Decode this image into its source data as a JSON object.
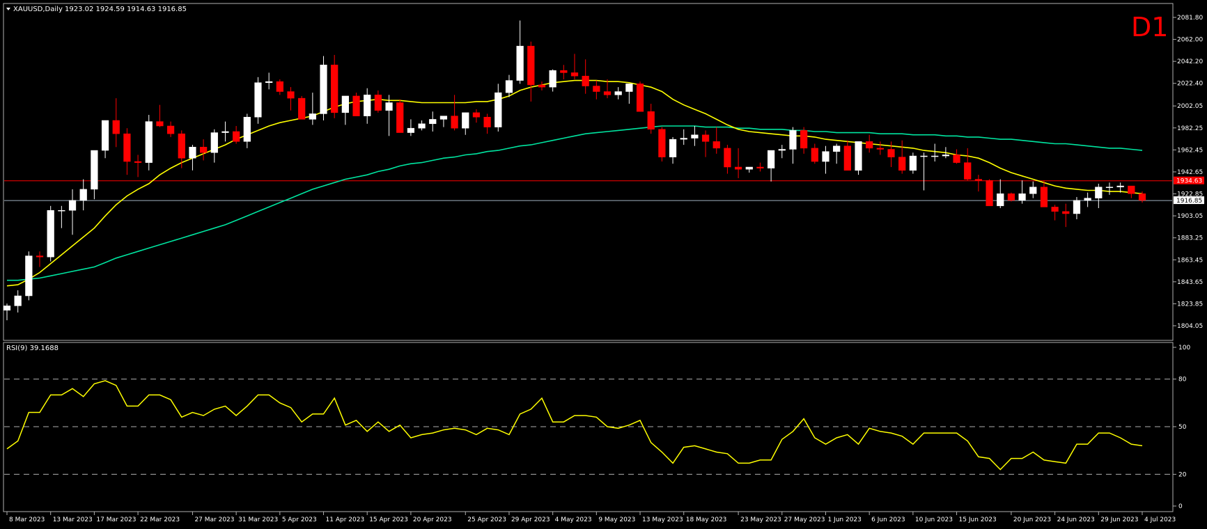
{
  "header": {
    "symbol": "XAUUSD,Daily",
    "ohlc": "1923.02 1924.59 1914.63 1916.85",
    "timeframe": "D1"
  },
  "rsi_label": "RSI(9) 39.1688",
  "price_axis": [
    "2081.80",
    "2062.00",
    "2042.20",
    "2022.40",
    "2002.05",
    "1982.25",
    "1962.45",
    "1942.65",
    "1922.85",
    "1903.05",
    "1883.25",
    "1863.45",
    "1843.65",
    "1823.85",
    "1804.05"
  ],
  "rsi_axis": [
    "100",
    "80",
    "50",
    "20",
    "0"
  ],
  "price_tags": {
    "red_line": "1934.63",
    "current": "1916.85"
  },
  "date_labels": [
    "8 Mar 2023",
    "13 Mar 2023",
    "17 Mar 2023",
    "22 Mar 2023",
    "27 Mar 2023",
    "31 Mar 2023",
    "5 Apr 2023",
    "11 Apr 2023",
    "15 Apr 2023",
    "20 Apr 2023",
    "25 Apr 2023",
    "29 Apr 2023",
    "4 May 2023",
    "9 May 2023",
    "13 May 2023",
    "18 May 2023",
    "23 May 2023",
    "27 May 2023",
    "1 Jun 2023",
    "6 Jun 2023",
    "10 Jun 2023",
    "15 Jun 2023",
    "20 Jun 2023",
    "24 Jun 2023",
    "29 Jun 2023",
    "4 Jul 2023"
  ],
  "colors": {
    "bull": "#ffffff",
    "bear": "#ff0000",
    "ma_fast": "#ffff00",
    "ma_slow": "#00e5a0",
    "rsi": "#ffff00",
    "h_red": "#ff0000",
    "h_current": "#a0b0c0"
  },
  "chart_data": {
    "type": "candlestick",
    "timeframe": "Daily",
    "ylim": [
      1804.05,
      2081.8
    ],
    "candles": [
      {
        "o": 1818,
        "h": 1824,
        "l": 1809,
        "c": 1822
      },
      {
        "o": 1822,
        "h": 1836,
        "l": 1816,
        "c": 1831
      },
      {
        "o": 1831,
        "h": 1871,
        "l": 1827,
        "c": 1867
      },
      {
        "o": 1867,
        "h": 1871,
        "l": 1857,
        "c": 1866
      },
      {
        "o": 1866,
        "h": 1912,
        "l": 1862,
        "c": 1908
      },
      {
        "o": 1908,
        "h": 1912,
        "l": 1892,
        "c": 1908
      },
      {
        "o": 1908,
        "h": 1927,
        "l": 1886,
        "c": 1917
      },
      {
        "o": 1917,
        "h": 1936,
        "l": 1908,
        "c": 1927
      },
      {
        "o": 1927,
        "h": 1939,
        "l": 1918,
        "c": 1962
      },
      {
        "o": 1962,
        "h": 1986,
        "l": 1955,
        "c": 1989
      },
      {
        "o": 1989,
        "h": 2009,
        "l": 1965,
        "c": 1977
      },
      {
        "o": 1977,
        "h": 1982,
        "l": 1940,
        "c": 1952
      },
      {
        "o": 1952,
        "h": 1958,
        "l": 1938,
        "c": 1951
      },
      {
        "o": 1951,
        "h": 1994,
        "l": 1944,
        "c": 1988
      },
      {
        "o": 1988,
        "h": 2003,
        "l": 1983,
        "c": 1984
      },
      {
        "o": 1984,
        "h": 1988,
        "l": 1974,
        "c": 1977
      },
      {
        "o": 1977,
        "h": 1980,
        "l": 1946,
        "c": 1955
      },
      {
        "o": 1955,
        "h": 1967,
        "l": 1944,
        "c": 1965
      },
      {
        "o": 1965,
        "h": 1972,
        "l": 1953,
        "c": 1960
      },
      {
        "o": 1960,
        "h": 1981,
        "l": 1951,
        "c": 1978
      },
      {
        "o": 1978,
        "h": 1988,
        "l": 1970,
        "c": 1979
      },
      {
        "o": 1979,
        "h": 1984,
        "l": 1968,
        "c": 1970
      },
      {
        "o": 1970,
        "h": 1995,
        "l": 1964,
        "c": 1992
      },
      {
        "o": 1992,
        "h": 2028,
        "l": 1986,
        "c": 2023
      },
      {
        "o": 2023,
        "h": 2032,
        "l": 2017,
        "c": 2024
      },
      {
        "o": 2024,
        "h": 2026,
        "l": 2012,
        "c": 2015
      },
      {
        "o": 2015,
        "h": 2019,
        "l": 1998,
        "c": 2009
      },
      {
        "o": 2009,
        "h": 2011,
        "l": 1992,
        "c": 1990
      },
      {
        "o": 1990,
        "h": 2014,
        "l": 1985,
        "c": 1995
      },
      {
        "o": 1995,
        "h": 2047,
        "l": 1989,
        "c": 2039
      },
      {
        "o": 2039,
        "h": 2048,
        "l": 1991,
        "c": 1996
      },
      {
        "o": 1996,
        "h": 2008,
        "l": 1985,
        "c": 2011
      },
      {
        "o": 2011,
        "h": 2014,
        "l": 1998,
        "c": 1993
      },
      {
        "o": 1993,
        "h": 2018,
        "l": 1986,
        "c": 2012
      },
      {
        "o": 2012,
        "h": 2016,
        "l": 1996,
        "c": 1998
      },
      {
        "o": 1998,
        "h": 2012,
        "l": 1975,
        "c": 2005
      },
      {
        "o": 2005,
        "h": 2008,
        "l": 1978,
        "c": 1978
      },
      {
        "o": 1978,
        "h": 1990,
        "l": 1975,
        "c": 1982
      },
      {
        "o": 1982,
        "h": 1989,
        "l": 1980,
        "c": 1986
      },
      {
        "o": 1986,
        "h": 1997,
        "l": 1979,
        "c": 1990
      },
      {
        "o": 1990,
        "h": 1992,
        "l": 1983,
        "c": 1993
      },
      {
        "o": 1993,
        "h": 2012,
        "l": 1980,
        "c": 1982
      },
      {
        "o": 1982,
        "h": 1996,
        "l": 1976,
        "c": 1996
      },
      {
        "o": 1996,
        "h": 1999,
        "l": 1987,
        "c": 1992
      },
      {
        "o": 1992,
        "h": 1995,
        "l": 1977,
        "c": 1983
      },
      {
        "o": 1983,
        "h": 2022,
        "l": 1979,
        "c": 2014
      },
      {
        "o": 2014,
        "h": 2030,
        "l": 2010,
        "c": 2025
      },
      {
        "o": 2025,
        "h": 2079,
        "l": 2022,
        "c": 2056
      },
      {
        "o": 2056,
        "h": 2060,
        "l": 2006,
        "c": 2021
      },
      {
        "o": 2021,
        "h": 2024,
        "l": 2016,
        "c": 2019
      },
      {
        "o": 2019,
        "h": 2035,
        "l": 2015,
        "c": 2034
      },
      {
        "o": 2034,
        "h": 2039,
        "l": 2026,
        "c": 2032
      },
      {
        "o": 2032,
        "h": 2049,
        "l": 2026,
        "c": 2029
      },
      {
        "o": 2029,
        "h": 2044,
        "l": 2013,
        "c": 2020
      },
      {
        "o": 2020,
        "h": 2025,
        "l": 2008,
        "c": 2015
      },
      {
        "o": 2015,
        "h": 2026,
        "l": 2009,
        "c": 2012
      },
      {
        "o": 2012,
        "h": 2019,
        "l": 2008,
        "c": 2015
      },
      {
        "o": 2015,
        "h": 2022,
        "l": 2004,
        "c": 2022
      },
      {
        "o": 2022,
        "h": 2024,
        "l": 1997,
        "c": 1997
      },
      {
        "o": 1997,
        "h": 2004,
        "l": 1977,
        "c": 1981
      },
      {
        "o": 1981,
        "h": 1983,
        "l": 1952,
        "c": 1956
      },
      {
        "o": 1956,
        "h": 1974,
        "l": 1950,
        "c": 1972
      },
      {
        "o": 1972,
        "h": 1981,
        "l": 1967,
        "c": 1973
      },
      {
        "o": 1973,
        "h": 1984,
        "l": 1966,
        "c": 1976
      },
      {
        "o": 1976,
        "h": 1980,
        "l": 1956,
        "c": 1970
      },
      {
        "o": 1970,
        "h": 1983,
        "l": 1959,
        "c": 1964
      },
      {
        "o": 1964,
        "h": 1967,
        "l": 1941,
        "c": 1947
      },
      {
        "o": 1947,
        "h": 1964,
        "l": 1937,
        "c": 1945
      },
      {
        "o": 1945,
        "h": 1947,
        "l": 1942,
        "c": 1947
      },
      {
        "o": 1947,
        "h": 1951,
        "l": 1943,
        "c": 1946
      },
      {
        "o": 1946,
        "h": 1951,
        "l": 1934,
        "c": 1962
      },
      {
        "o": 1962,
        "h": 1967,
        "l": 1955,
        "c": 1963
      },
      {
        "o": 1963,
        "h": 1983,
        "l": 1950,
        "c": 1980
      },
      {
        "o": 1980,
        "h": 1983,
        "l": 1959,
        "c": 1964
      },
      {
        "o": 1964,
        "h": 1968,
        "l": 1950,
        "c": 1952
      },
      {
        "o": 1952,
        "h": 1966,
        "l": 1941,
        "c": 1961
      },
      {
        "o": 1961,
        "h": 1968,
        "l": 1950,
        "c": 1966
      },
      {
        "o": 1966,
        "h": 1971,
        "l": 1945,
        "c": 1944
      },
      {
        "o": 1944,
        "h": 1970,
        "l": 1940,
        "c": 1970
      },
      {
        "o": 1970,
        "h": 1976,
        "l": 1960,
        "c": 1964
      },
      {
        "o": 1964,
        "h": 1970,
        "l": 1958,
        "c": 1963
      },
      {
        "o": 1963,
        "h": 1970,
        "l": 1947,
        "c": 1956
      },
      {
        "o": 1956,
        "h": 1971,
        "l": 1941,
        "c": 1944
      },
      {
        "o": 1944,
        "h": 1960,
        "l": 1941,
        "c": 1957
      },
      {
        "o": 1957,
        "h": 1960,
        "l": 1926,
        "c": 1957
      },
      {
        "o": 1957,
        "h": 1968,
        "l": 1952,
        "c": 1957
      },
      {
        "o": 1957,
        "h": 1965,
        "l": 1955,
        "c": 1958
      },
      {
        "o": 1958,
        "h": 1963,
        "l": 1950,
        "c": 1951
      },
      {
        "o": 1951,
        "h": 1964,
        "l": 1935,
        "c": 1936
      },
      {
        "o": 1936,
        "h": 1940,
        "l": 1925,
        "c": 1935
      },
      {
        "o": 1935,
        "h": 1936,
        "l": 1912,
        "c": 1912
      },
      {
        "o": 1912,
        "h": 1936,
        "l": 1910,
        "c": 1923
      },
      {
        "o": 1923,
        "h": 1924,
        "l": 1916,
        "c": 1917
      },
      {
        "o": 1917,
        "h": 1935,
        "l": 1914,
        "c": 1923
      },
      {
        "o": 1923,
        "h": 1934,
        "l": 1919,
        "c": 1929
      },
      {
        "o": 1929,
        "h": 1935,
        "l": 1912,
        "c": 1911
      },
      {
        "o": 1911,
        "h": 1913,
        "l": 1899,
        "c": 1907
      },
      {
        "o": 1907,
        "h": 1914,
        "l": 1893,
        "c": 1905
      },
      {
        "o": 1905,
        "h": 1920,
        "l": 1900,
        "c": 1917
      },
      {
        "o": 1917,
        "h": 1924,
        "l": 1911,
        "c": 1919
      },
      {
        "o": 1919,
        "h": 1932,
        "l": 1910,
        "c": 1929
      },
      {
        "o": 1929,
        "h": 1933,
        "l": 1922,
        "c": 1929
      },
      {
        "o": 1929,
        "h": 1933,
        "l": 1924,
        "c": 1930
      },
      {
        "o": 1930,
        "h": 1930,
        "l": 1919,
        "c": 1923
      },
      {
        "o": 1923,
        "h": 1925,
        "l": 1915,
        "c": 1917
      }
    ],
    "ma_fast": [
      1840,
      1841,
      1846,
      1852,
      1860,
      1868,
      1876,
      1884,
      1892,
      1903,
      1913,
      1921,
      1927,
      1932,
      1940,
      1946,
      1951,
      1955,
      1959,
      1963,
      1967,
      1972,
      1976,
      1980,
      1984,
      1987,
      1989,
      1991,
      1993,
      1997,
      2001,
      2004,
      2006,
      2007,
      2008,
      2007,
      2007,
      2006,
      2005,
      2005,
      2005,
      2005,
      2005,
      2006,
      2006,
      2008,
      2011,
      2016,
      2019,
      2021,
      2023,
      2024,
      2025,
      2025,
      2025,
      2024,
      2024,
      2023,
      2021,
      2019,
      2015,
      2008,
      2003,
      1999,
      1995,
      1990,
      1985,
      1981,
      1979,
      1978,
      1977,
      1976,
      1975,
      1975,
      1974,
      1972,
      1971,
      1970,
      1969,
      1968,
      1967,
      1966,
      1965,
      1964,
      1962,
      1961,
      1960,
      1958,
      1957,
      1955,
      1951,
      1946,
      1942,
      1939,
      1936,
      1933,
      1930,
      1928,
      1927,
      1926,
      1926,
      1925,
      1925,
      1924,
      1923
    ],
    "ma_slow": [
      1845,
      1845,
      1846,
      1847,
      1849,
      1851,
      1853,
      1855,
      1857,
      1861,
      1865,
      1868,
      1871,
      1874,
      1877,
      1880,
      1883,
      1886,
      1889,
      1892,
      1895,
      1899,
      1903,
      1907,
      1911,
      1915,
      1919,
      1923,
      1927,
      1930,
      1933,
      1936,
      1938,
      1940,
      1943,
      1945,
      1948,
      1950,
      1951,
      1953,
      1955,
      1956,
      1958,
      1959,
      1961,
      1962,
      1964,
      1966,
      1967,
      1969,
      1971,
      1973,
      1975,
      1977,
      1978,
      1979,
      1980,
      1981,
      1982,
      1983,
      1984,
      1984,
      1984,
      1984,
      1983,
      1983,
      1983,
      1982,
      1982,
      1981,
      1981,
      1981,
      1980,
      1980,
      1979,
      1979,
      1978,
      1978,
      1978,
      1978,
      1977,
      1977,
      1977,
      1976,
      1976,
      1976,
      1975,
      1975,
      1974,
      1974,
      1973,
      1972,
      1972,
      1971,
      1970,
      1969,
      1968,
      1968,
      1967,
      1966,
      1965,
      1964,
      1964,
      1963,
      1962
    ],
    "rsi": [
      36,
      41,
      59,
      59,
      70,
      70,
      74,
      69,
      77,
      79,
      76,
      63,
      63,
      70,
      70,
      67,
      56,
      59,
      57,
      61,
      63,
      57,
      63,
      70,
      70,
      65,
      62,
      53,
      58,
      58,
      68,
      51,
      54,
      47,
      53,
      47,
      51,
      43,
      45,
      46,
      48,
      49,
      48,
      45,
      49,
      48,
      45,
      58,
      61,
      68,
      53,
      53,
      57,
      57,
      56,
      50,
      49,
      51,
      54,
      40,
      34,
      27,
      37,
      38,
      36,
      34,
      33,
      27,
      27,
      29,
      29,
      42,
      47,
      55,
      43,
      39,
      43,
      45,
      39,
      49,
      47,
      46,
      44,
      39,
      46,
      46,
      46,
      46,
      41,
      31,
      30,
      23,
      30,
      30,
      34,
      29,
      28,
      27,
      39,
      39,
      46,
      46,
      43,
      39,
      38
    ],
    "rsi_levels": [
      80,
      50,
      20
    ],
    "rsi_ylim": [
      0,
      100
    ],
    "h_lines": [
      1934.63,
      1916.85
    ]
  }
}
